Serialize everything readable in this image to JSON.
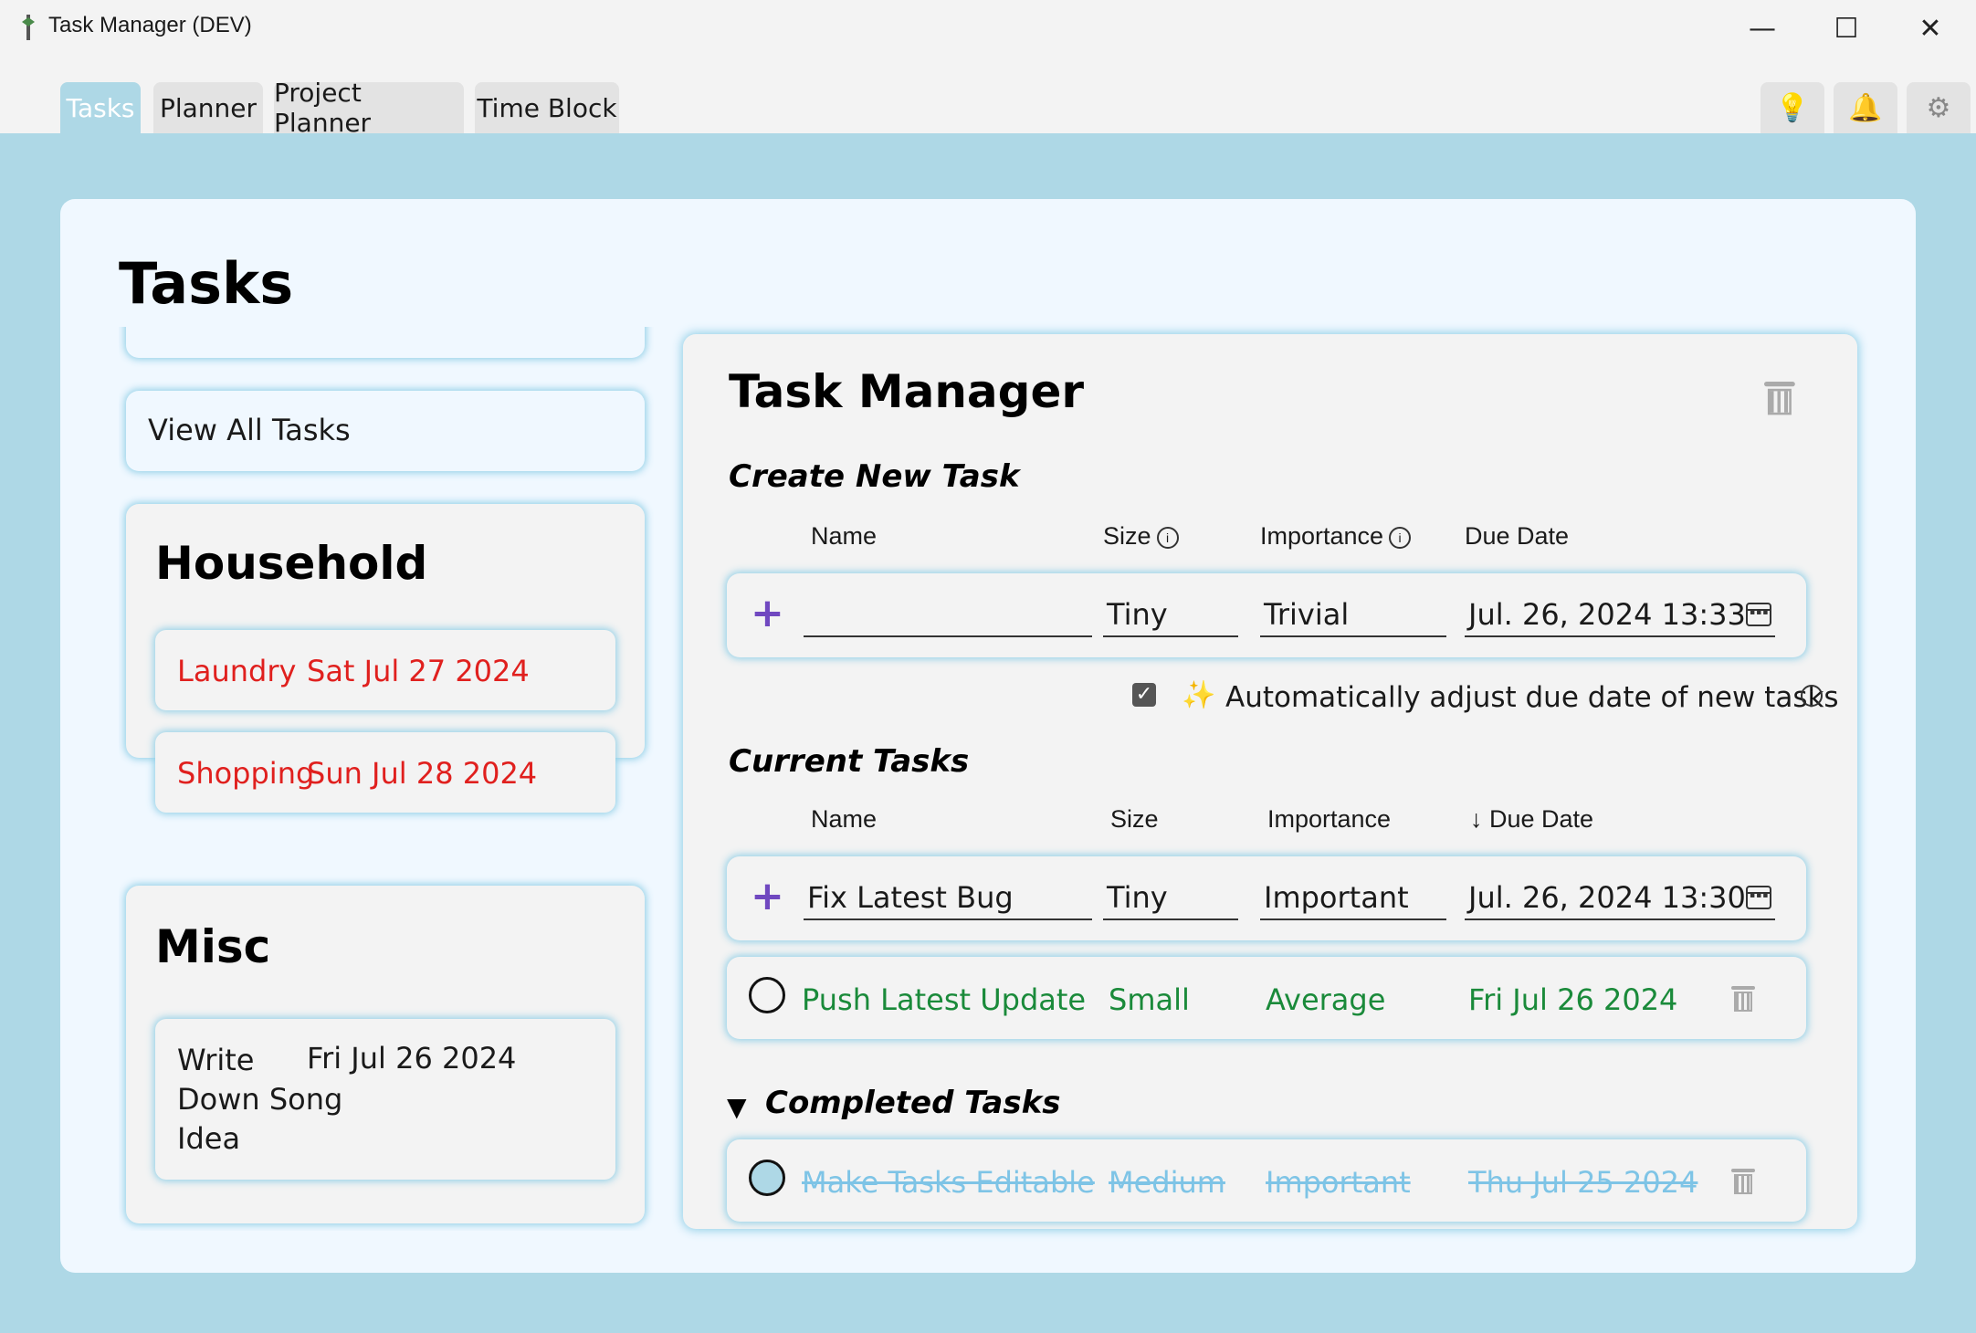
{
  "window": {
    "title": "Task Manager (DEV)",
    "controls": {
      "minimize": "—",
      "maximize": "☐",
      "close": "✕"
    }
  },
  "tabs": [
    {
      "label": "Tasks",
      "active": true
    },
    {
      "label": "Planner",
      "active": false
    },
    {
      "label": "Project Planner",
      "active": false
    },
    {
      "label": "Time Block",
      "active": false
    }
  ],
  "toolbar": {
    "ideas_icon": "💡",
    "notifications_icon": "🔔",
    "settings_icon": "⚙"
  },
  "page": {
    "title": "Tasks"
  },
  "sidebar": {
    "view_all_label": "View All Tasks",
    "groups": [
      {
        "name": "Household",
        "items": [
          {
            "name": "Laundry",
            "date": "Sat Jul 27 2024",
            "status_color": "#e0201e"
          },
          {
            "name": "Shopping",
            "date": "Sun Jul 28 2024",
            "status_color": "#e0201e"
          }
        ]
      },
      {
        "name": "Misc",
        "items": [
          {
            "name_lines": [
              "Write",
              "Down Song",
              "Idea"
            ],
            "date": "Fri Jul 26 2024"
          }
        ]
      }
    ]
  },
  "task_manager": {
    "title": "Task Manager",
    "create": {
      "heading": "Create New Task",
      "columns": {
        "name": "Name",
        "size": "Size",
        "importance": "Importance",
        "due_date": "Due Date"
      },
      "info_icon": "i",
      "plus_icon": "+",
      "name_value": "",
      "size_value": "Tiny",
      "importance_value": "Trivial",
      "due_value": "Jul. 26, 2024  13:33"
    },
    "auto_adjust": {
      "checked": true,
      "sparkle_icon": "✨",
      "label": "Automatically adjust due date of new tasks"
    },
    "current": {
      "heading": "Current Tasks",
      "columns": {
        "name": "Name",
        "size": "Size",
        "importance": "Importance",
        "due_date": "↓ Due Date"
      },
      "editing_row": {
        "name": "Fix Latest Bug",
        "size": "Tiny",
        "importance": "Important",
        "due": "Jul. 26, 2024  13:30"
      },
      "tasks": [
        {
          "name": "Push Latest Update",
          "size": "Small",
          "importance": "Average",
          "due": "Fri Jul 26 2024",
          "color": "#1a8a3a"
        }
      ]
    },
    "completed": {
      "toggle_icon": "▼",
      "heading": "Completed Tasks",
      "tasks": [
        {
          "name": "Make Tasks Editable",
          "size": "Medium",
          "importance": "Important",
          "due": "Thu Jul 25 2024",
          "color": "#7ec4e6"
        }
      ]
    }
  },
  "colors": {
    "background": "#aed8e6",
    "card": "#f0f8ff",
    "overdue": "#e0201e",
    "due_today": "#1a8a3a",
    "completed": "#7ec4e6",
    "accent_plus": "#7048c0"
  }
}
